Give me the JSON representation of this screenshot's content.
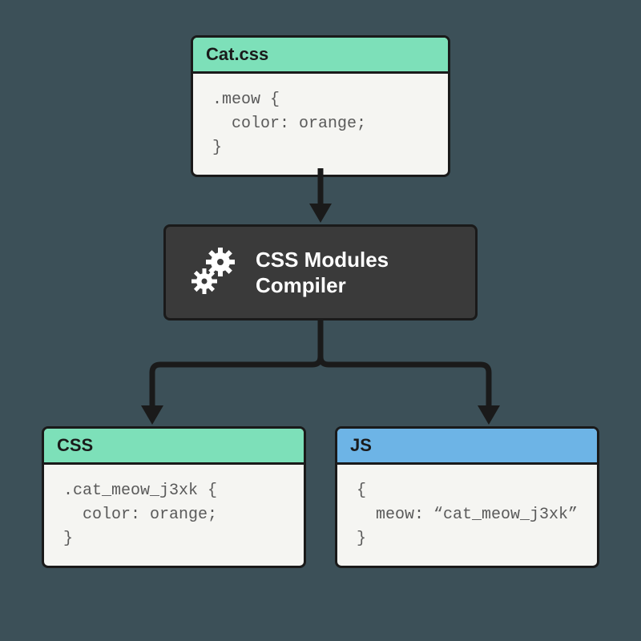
{
  "source": {
    "title": "Cat.css",
    "code": ".meow {\n  color: orange;\n}"
  },
  "compiler": {
    "label": "CSS Modules\nCompiler"
  },
  "outputs": {
    "css": {
      "title": "CSS",
      "code": ".cat_meow_j3xk {\n  color: orange;\n}"
    },
    "js": {
      "title": "JS",
      "code": "{\n  meow: “cat_meow_j3xk”\n}"
    }
  }
}
